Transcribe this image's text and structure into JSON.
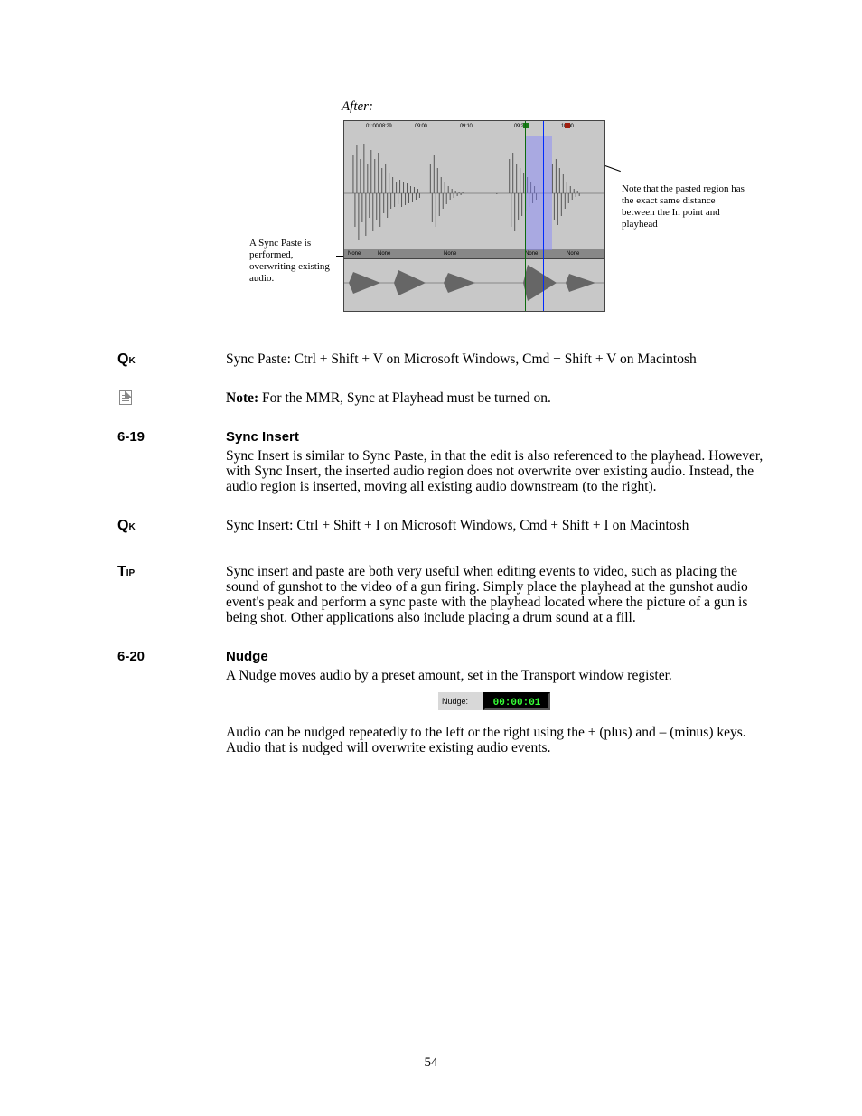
{
  "figure": {
    "caption": "After:",
    "ruler_labels": [
      "01:00:08:29",
      "09:00",
      "09:10",
      "09:20",
      "10:00"
    ],
    "track_labels": [
      "None",
      "None",
      "None",
      "None",
      "None"
    ],
    "note_left": "A Sync Paste is performed, overwriting existing audio.",
    "note_right": "Note that the pasted region has the exact same distance between the In point and playhead"
  },
  "block_qk1": "Sync Paste: Ctrl + Shift + V on Microsoft Windows, Cmd + Shift + V on Macintosh",
  "block_note": {
    "label": "Note:",
    "text": " For the MMR, Sync at Playhead must be turned on."
  },
  "sec619": {
    "num": "6-19",
    "title": "Sync Insert",
    "para": "Sync Insert is similar to Sync Paste, in that the edit is also referenced to the playhead. However, with Sync Insert, the inserted audio region does not overwrite over existing audio. Instead, the audio region is inserted, moving all existing audio downstream (to the right)."
  },
  "block_qk2": "Sync Insert: Ctrl + Shift + I on Microsoft Windows, Cmd + Shift + I on Macintosh",
  "block_tip": "Sync insert and paste are both very useful when editing events to video, such as placing the sound of gunshot to the video of a gun firing. Simply place the playhead at the gunshot audio event's peak and perform a sync paste with the playhead located where the picture of a gun is being shot. Other applications also include placing a drum sound at a fill.",
  "sec620": {
    "num": "6-20",
    "title": "Nudge",
    "para1": "A Nudge moves audio by a preset amount, set in the Transport window register.",
    "widget_label": "Nudge:",
    "widget_value": "00:00:01",
    "para2": "Audio can be nudged repeatedly to the left or the right using the + (plus) and – (minus) keys. Audio that is nudged will overwrite existing audio events."
  },
  "page_number": "54",
  "icon_labels": {
    "qk": "Q",
    "qk_sub": "K",
    "tip": "T",
    "tip_sub": "IP"
  }
}
